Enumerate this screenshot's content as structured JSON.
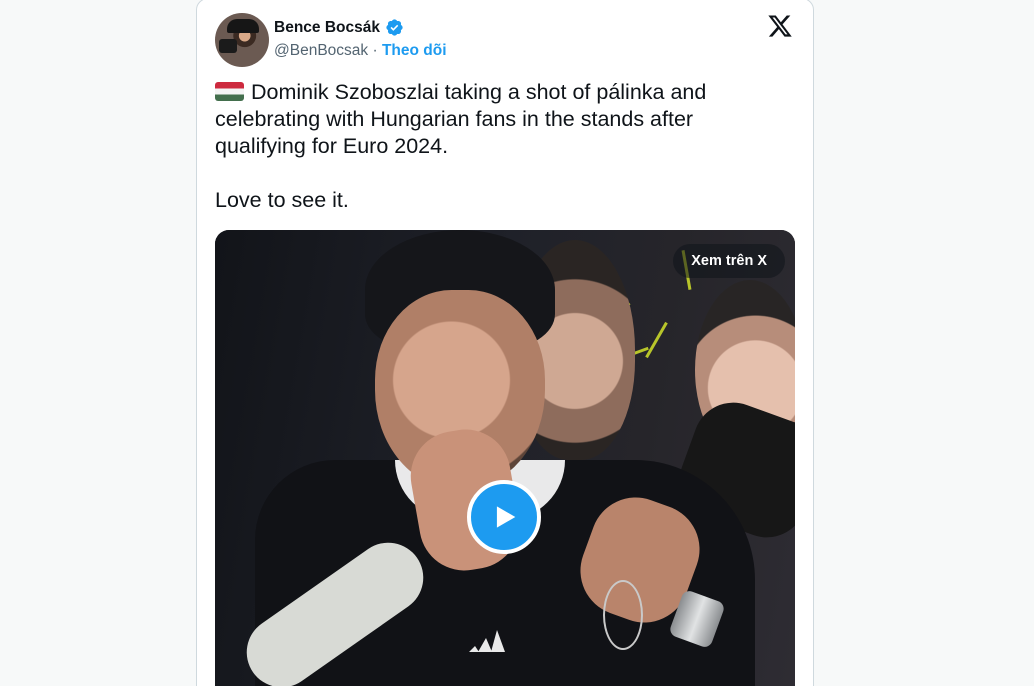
{
  "tweet": {
    "author": {
      "name": "Bence Bocsák",
      "handle": "@BenBocsak",
      "separator": "·",
      "follow_label": "Theo dõi",
      "verified": true,
      "verified_color": "#1d9bf0"
    },
    "text_line1": "Dominik Szoboszlai taking a shot of pálinka and celebrating with Hungarian fans in the stands after qualifying for Euro 2024.",
    "text_line2": "Love to see it.",
    "flag_icon": "hungary-flag-icon",
    "media": {
      "view_on_x_label": "Xem trên X",
      "play_icon": "play-icon",
      "jersey_brand": "adidas"
    },
    "platform_icon": "x-logo-icon"
  },
  "colors": {
    "accent": "#1d9bf0",
    "text": "#0f1419",
    "muted": "#536471"
  }
}
